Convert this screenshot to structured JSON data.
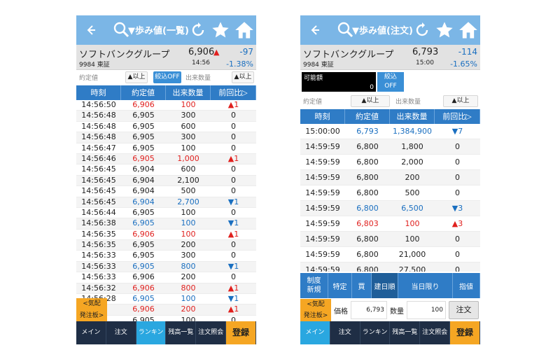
{
  "colors": {
    "header": "#7bb6e6",
    "table_header": "#2f7cc6",
    "up": "#e0201e",
    "down": "#1a6fc0",
    "accent": "#f5a623"
  },
  "left": {
    "title": "▼歩み値(一覧)",
    "stock_name": "ソフトバンクグループ",
    "price": "6,906",
    "price_arrow": "▲",
    "change": "-97",
    "code": "9984 東証",
    "time": "14:56",
    "pct": "-1.38%",
    "filter": {
      "label1": "約定値",
      "btn1": "▲以上",
      "btn2": "絞込OFF",
      "label2": "出来数量",
      "btn3": "▲以上"
    },
    "columns": [
      "時刻",
      "約定値",
      "出来数量",
      "前回比▷"
    ],
    "rows": [
      {
        "t": "14:56:50",
        "p": "6,906",
        "q": "100",
        "d": "▲1",
        "pc": "red",
        "dc": "up"
      },
      {
        "t": "14:56:48",
        "p": "6,905",
        "q": "300",
        "d": "0",
        "pc": "",
        "dc": ""
      },
      {
        "t": "14:56:48",
        "p": "6,905",
        "q": "600",
        "d": "0",
        "pc": "",
        "dc": ""
      },
      {
        "t": "14:56:48",
        "p": "6,905",
        "q": "300",
        "d": "0",
        "pc": "",
        "dc": ""
      },
      {
        "t": "14:56:47",
        "p": "6,905",
        "q": "100",
        "d": "0",
        "pc": "",
        "dc": ""
      },
      {
        "t": "14:56:46",
        "p": "6,905",
        "q": "1,000",
        "d": "▲1",
        "pc": "red",
        "dc": "up"
      },
      {
        "t": "14:56:45",
        "p": "6,904",
        "q": "600",
        "d": "0",
        "pc": "",
        "dc": ""
      },
      {
        "t": "14:56:45",
        "p": "6,904",
        "q": "2,100",
        "d": "0",
        "pc": "",
        "dc": ""
      },
      {
        "t": "14:56:45",
        "p": "6,904",
        "q": "500",
        "d": "0",
        "pc": "",
        "dc": ""
      },
      {
        "t": "14:56:45",
        "p": "6,904",
        "q": "2,700",
        "d": "▼1",
        "pc": "blue",
        "dc": "dn"
      },
      {
        "t": "14:56:44",
        "p": "6,905",
        "q": "100",
        "d": "0",
        "pc": "",
        "dc": ""
      },
      {
        "t": "14:56:38",
        "p": "6,905",
        "q": "100",
        "d": "▼1",
        "pc": "blue",
        "dc": "dn"
      },
      {
        "t": "14:56:35",
        "p": "6,906",
        "q": "100",
        "d": "▲1",
        "pc": "red",
        "dc": "up"
      },
      {
        "t": "14:56:35",
        "p": "6,905",
        "q": "200",
        "d": "0",
        "pc": "",
        "dc": ""
      },
      {
        "t": "14:56:33",
        "p": "6,905",
        "q": "300",
        "d": "0",
        "pc": "",
        "dc": ""
      },
      {
        "t": "14:56:33",
        "p": "6,905",
        "q": "800",
        "d": "▼1",
        "pc": "blue",
        "dc": "dn"
      },
      {
        "t": "14:56:33",
        "p": "6,906",
        "q": "200",
        "d": "0",
        "pc": "",
        "dc": ""
      },
      {
        "t": "14:56:32",
        "p": "6,906",
        "q": "800",
        "d": "▲1",
        "pc": "red",
        "dc": "up"
      },
      {
        "t": "14:56:28",
        "p": "6,905",
        "q": "100",
        "d": "▼1",
        "pc": "blue",
        "dc": "dn"
      },
      {
        "t": "28",
        "p": "6,906",
        "q": "200",
        "d": "▲1",
        "pc": "red",
        "dc": "up"
      },
      {
        "t": "28",
        "p": "6,905",
        "q": "100",
        "d": "0",
        "pc": "",
        "dc": ""
      }
    ],
    "side": {
      "kihai": "<気配",
      "hacchu": "発注板>"
    },
    "nav": [
      "メイン",
      "注文",
      "ランキング",
      "残高一覧",
      "注文照会",
      "登録"
    ]
  },
  "right": {
    "title": "▼歩み値(注文)",
    "stock_name": "ソフトバンクグループ",
    "price": "6,793",
    "change": "-114",
    "code": "9984 東証",
    "time": "15:00",
    "pct": "-1.65%",
    "available_label": "可能額",
    "available_value": "0",
    "filter_toggle": "絞込\nOFF",
    "filter": {
      "label1": "約定値",
      "btn1": "▲以上",
      "label2": "出来数量",
      "btn3": "▲以上"
    },
    "columns": [
      "時刻",
      "約定値",
      "出来数量",
      "前回比▷"
    ],
    "rows": [
      {
        "t": "15:00:00",
        "p": "6,793",
        "q": "1,384,900",
        "d": "▼7",
        "pc": "blue",
        "dc": "dn"
      },
      {
        "t": "14:59:59",
        "p": "6,800",
        "q": "1,800",
        "d": "0",
        "pc": "",
        "dc": ""
      },
      {
        "t": "14:59:59",
        "p": "6,800",
        "q": "2,000",
        "d": "0",
        "pc": "",
        "dc": ""
      },
      {
        "t": "14:59:59",
        "p": "6,800",
        "q": "200",
        "d": "0",
        "pc": "",
        "dc": ""
      },
      {
        "t": "14:59:59",
        "p": "6,800",
        "q": "500",
        "d": "0",
        "pc": "",
        "dc": ""
      },
      {
        "t": "14:59:59",
        "p": "6,800",
        "q": "6,500",
        "d": "▼3",
        "pc": "blue",
        "dc": "dn"
      },
      {
        "t": "14:59:59",
        "p": "6,803",
        "q": "100",
        "d": "▲3",
        "pc": "red",
        "dc": "up"
      },
      {
        "t": "14:59:59",
        "p": "6,800",
        "q": "100",
        "d": "0",
        "pc": "",
        "dc": ""
      },
      {
        "t": "14:59:59",
        "p": "6,800",
        "q": "21,000",
        "d": "0",
        "pc": "",
        "dc": ""
      },
      {
        "t": "14:59:59",
        "p": "6,800",
        "q": "27,500",
        "d": "0",
        "pc": "",
        "dc": ""
      }
    ],
    "order": {
      "seido": "制度",
      "shinki": "新規",
      "tokutei": "特定",
      "kai": "買",
      "toujitsu": "建日順",
      "touhi": "当日限り",
      "sashine": "指値"
    },
    "side": {
      "kihai": "<気配",
      "hacchu": "発注板>"
    },
    "price_label": "価格",
    "price_value": "6,793",
    "qty_label": "数量",
    "qty_value": "100",
    "order_button": "注文",
    "nav": [
      "メイン",
      "注文",
      "ランキング",
      "残高一覧",
      "注文照会",
      "登録"
    ]
  }
}
